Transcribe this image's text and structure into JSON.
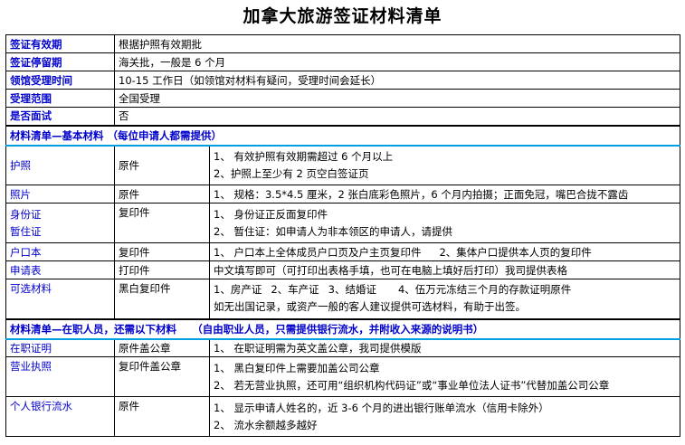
{
  "title": "加拿大旅游签证材料清单",
  "info": [
    {
      "label": "签证有效期",
      "value": "根据护照有效期批"
    },
    {
      "label": "签证停留期",
      "value": "海关批，一般是 6 个月"
    },
    {
      "label": "领馆受理时间",
      "value": "10-15 工作日（如领馆对材料有疑问，受理时间会延长）"
    },
    {
      "label": "受理范围",
      "value": "全国受理"
    },
    {
      "label": "是否面试",
      "value": "否"
    }
  ],
  "section_basic": "材料清单—基本材料 （每位申请人都需提供）",
  "basic": {
    "passport": {
      "label": "护照",
      "type": "原件",
      "req1": "1、 有效护照有效期需超过 6 个月以上",
      "req2": "2、护照上至少有 2 页空白签证页"
    },
    "photo": {
      "label": "照片",
      "type": "原件",
      "req": "1、 规格：3.5*4.5 厘米，2 张白底彩色照片，6 个月内拍摄；正面免冠，嘴巴合拢不露齿"
    },
    "idcard": {
      "label1": "身份证",
      "label2": "暂住证",
      "type": "复印件",
      "req1": "1、 身份证正反面复印件",
      "req2": "2、 暂住证：如申请人为非本领区的申请人，请提供"
    },
    "hukou": {
      "label": "户口本",
      "type": "复印件",
      "req_a": "1、 户口本上全体成员户口页及户主页复印件",
      "req_b": "2、集体户口提供本人页的复印件"
    },
    "form": {
      "label": "申请表",
      "type": "打印件",
      "req": "中文填写即可（可打印出表格手填，也可在电脑上填好后打印）我司提供表格"
    },
    "optional": {
      "label": "可选材料",
      "type": "黑白复印件",
      "items": [
        "1、房产证",
        "2、车产证",
        "3、结婚证",
        "4、伍万元冻结三个月的存款证明原件"
      ],
      "note": "如无出国记录，或资产一般的客人建议提供可选材料，有助于出签。"
    }
  },
  "section_employed": "材料清单—在职人员，还需以下材料　　（自由职业人员，只需提供银行流水，并附收入来源的说明书）",
  "employed": {
    "employment": {
      "label": "在职证明",
      "type": "原件盖公章",
      "req": "1、 在职证明需为英文盖公章，我司提供模版"
    },
    "license": {
      "label": "营业执照",
      "type": "复印件盖公章",
      "req1": "1、 黑白复印件上需要加盖公司公章",
      "req2": "2、 若无营业执照，还可用“组织机构代码证”或“事业单位法人证书”代替加盖公司公章"
    },
    "bank": {
      "label": "个人银行流水",
      "type": "原件",
      "req1": "1、 显示申请人姓名的，近 3-6 个月的进出银行账单流水（信用卡除外）",
      "req2": "2、 流水余额越多越好"
    }
  }
}
